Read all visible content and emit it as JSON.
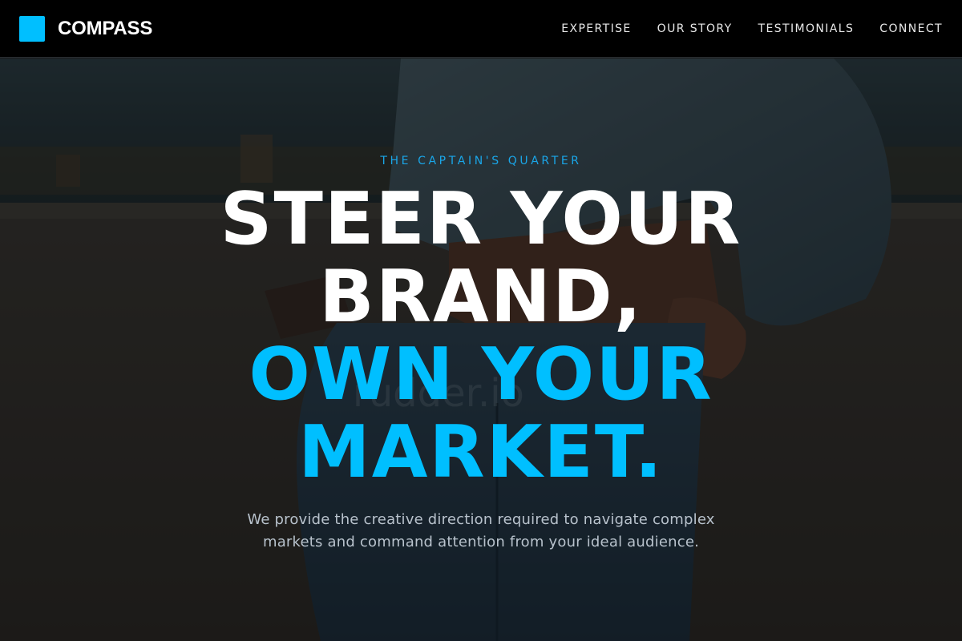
{
  "nav": {
    "brand": "COMPASS",
    "links": [
      "EXPERTISE",
      "OUR STORY",
      "TESTIMONIALS",
      "CONNECT"
    ]
  },
  "hero": {
    "eyebrow": "THE CAPTAIN'S QUARTER",
    "headline": {
      "line1": "STEER YOUR",
      "line2": "BRAND,",
      "line3": "OWN YOUR",
      "line4": "MARKET."
    },
    "subtext": "We provide the creative direction required to navigate complex markets and command attention from your ideal audience.",
    "watermark": "rudder.io"
  },
  "colors": {
    "accent": "#00bfff",
    "navbar": "#000000",
    "headline_white": "#ffffff",
    "subtext": "#b8c2cc"
  },
  "icons": {
    "brand_logo": "brand-square-logo"
  }
}
